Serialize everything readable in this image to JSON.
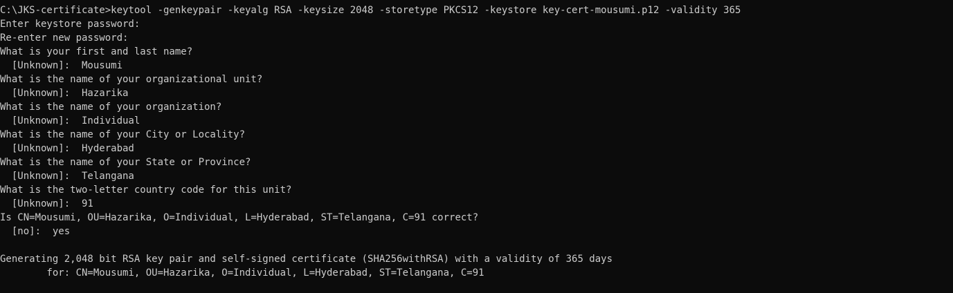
{
  "console": {
    "lines": [
      "C:\\JKS-certificate>keytool -genkeypair -keyalg RSA -keysize 2048 -storetype PKCS12 -keystore key-cert-mousumi.p12 -validity 365",
      "Enter keystore password:",
      "Re-enter new password:",
      "What is your first and last name?",
      "  [Unknown]:  Mousumi",
      "What is the name of your organizational unit?",
      "  [Unknown]:  Hazarika",
      "What is the name of your organization?",
      "  [Unknown]:  Individual",
      "What is the name of your City or Locality?",
      "  [Unknown]:  Hyderabad",
      "What is the name of your State or Province?",
      "  [Unknown]:  Telangana",
      "What is the two-letter country code for this unit?",
      "  [Unknown]:  91",
      "Is CN=Mousumi, OU=Hazarika, O=Individual, L=Hyderabad, ST=Telangana, C=91 correct?",
      "  [no]:  yes",
      "",
      "Generating 2,048 bit RSA key pair and self-signed certificate (SHA256withRSA) with a validity of 365 days",
      "        for: CN=Mousumi, OU=Hazarika, O=Individual, L=Hyderabad, ST=Telangana, C=91"
    ]
  },
  "colors": {
    "background": "#0c0c0c",
    "text": "#cccccc"
  }
}
